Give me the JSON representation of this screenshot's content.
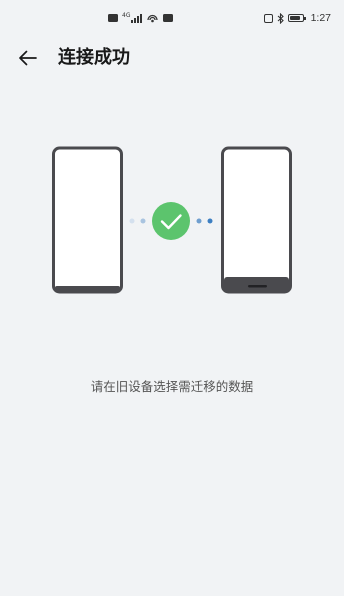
{
  "status_bar": {
    "time": "1:27",
    "network_type": "4G"
  },
  "header": {
    "title": "连接成功"
  },
  "illustration": {
    "status_icon": "check-circle-icon",
    "accent_color": "#5cc46d"
  },
  "instruction": {
    "text": "请在旧设备选择需迁移的数据"
  }
}
